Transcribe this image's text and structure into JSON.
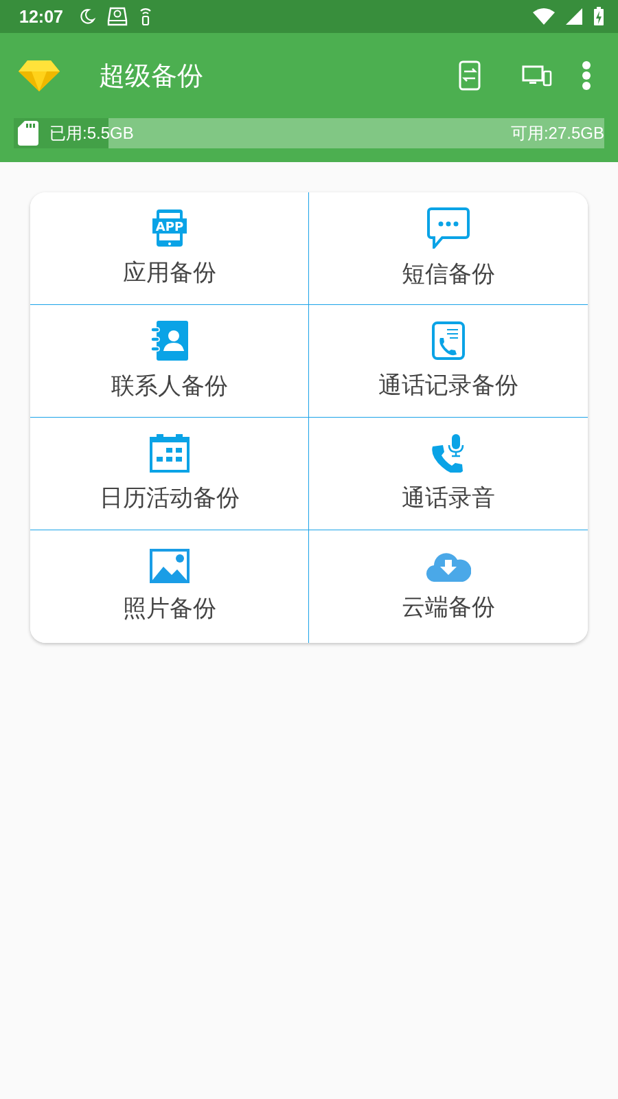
{
  "status_bar": {
    "time": "12:07"
  },
  "app_bar": {
    "title": "超级备份"
  },
  "storage": {
    "used": "已用:5.5GB",
    "free": "可用:27.5GB",
    "level": 0.16
  },
  "items": [
    {
      "label": "应用备份",
      "icon_text": "APP"
    },
    {
      "label": "短信备份"
    },
    {
      "label": "联系人备份"
    },
    {
      "label": "通话记录备份"
    },
    {
      "label": "日历活动备份"
    },
    {
      "label": "通话录音"
    },
    {
      "label": "照片备份"
    },
    {
      "label": "云端备份"
    }
  ]
}
